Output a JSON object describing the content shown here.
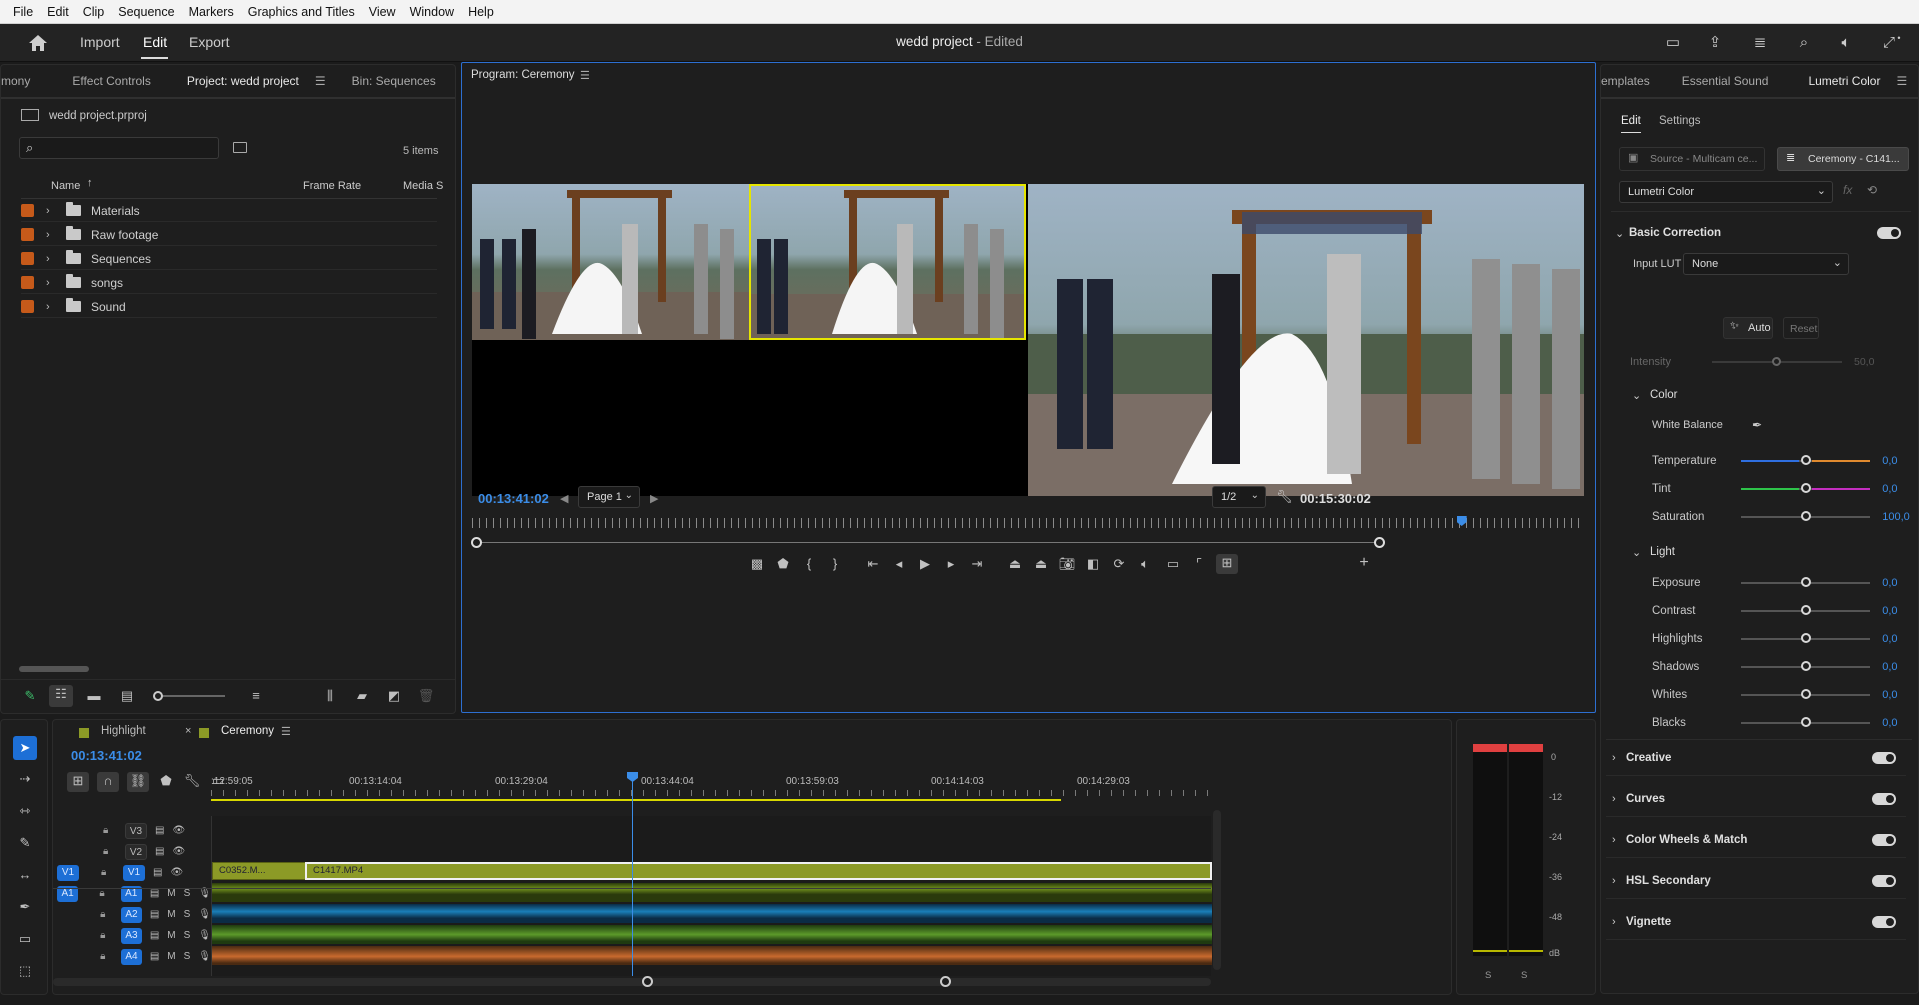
{
  "menu": [
    "File",
    "Edit",
    "Clip",
    "Sequence",
    "Markers",
    "Graphics and Titles",
    "View",
    "Window",
    "Help"
  ],
  "header": {
    "workspaces": [
      "Import",
      "Edit",
      "Export"
    ],
    "title": "wedd project",
    "title_suffix": " - Edited"
  },
  "project": {
    "tabs": [
      "mony",
      "Effect Controls",
      "Project: wedd project",
      "Bin: Sequences"
    ],
    "file": "wedd project.prproj",
    "item_count": "5 items",
    "columns": [
      "Name",
      "Frame Rate",
      "Media S"
    ],
    "items": [
      "Materials",
      "Raw footage",
      "Sequences",
      "songs",
      "Sound"
    ],
    "swatch_color": "#c65a1a"
  },
  "program": {
    "tab": "Program: Ceremony",
    "timecode_left": "00:13:41:02",
    "page": "Page 1",
    "resolution": "1/2",
    "timecode_right": "00:15:30:02",
    "playhead_fraction": 0.89
  },
  "timeline": {
    "tabs": [
      "Highlight",
      "Ceremony"
    ],
    "timecode": "00:13:41:02",
    "ruler": [
      ":12:59:05",
      "00:13:14:04",
      "00:13:29:04",
      "00:13:44:04",
      "00:13:59:03",
      "00:14:14:03",
      "00:14:29:03"
    ],
    "video_tracks": [
      "V3",
      "V2",
      "V1"
    ],
    "audio_tracks": [
      "A1",
      "A2",
      "A3",
      "A4"
    ],
    "clip_1": "C0352.M...",
    "clip_2": "C1417.MP4",
    "meter_scale": [
      "0",
      "-12",
      "-24",
      "-36",
      "-48",
      "dB"
    ],
    "meter_labels": [
      "S",
      "S"
    ],
    "colors": {
      "video_clip": "#8c9a26",
      "a1": "#6f8f1c",
      "a2": "#1a7fb8",
      "a3": "#5c9a2a",
      "a4": "#c86a2e",
      "playhead": "#3b8de8"
    }
  },
  "lumetri": {
    "tabs": [
      "emplates",
      "Essential Sound",
      "Lumetri Color"
    ],
    "subtabs": [
      "Edit",
      "Settings"
    ],
    "source": "Source - Multicam ce...",
    "target": "Ceremony - C141...",
    "effect": "Lumetri Color",
    "basic_correction": "Basic Correction",
    "input_lut_label": "Input LUT",
    "input_lut_value": "None",
    "auto": "Auto",
    "reset": "Reset",
    "intensity_label": "Intensity",
    "intensity_value": "50,0",
    "color_group": "Color",
    "white_balance": "White Balance",
    "color_controls": [
      {
        "label": "Temperature",
        "value": "0,0"
      },
      {
        "label": "Tint",
        "value": "0,0"
      },
      {
        "label": "Saturation",
        "value": "100,0"
      }
    ],
    "light_group": "Light",
    "light_controls": [
      {
        "label": "Exposure",
        "value": "0,0"
      },
      {
        "label": "Contrast",
        "value": "0,0"
      },
      {
        "label": "Highlights",
        "value": "0,0"
      },
      {
        "label": "Shadows",
        "value": "0,0"
      },
      {
        "label": "Whites",
        "value": "0,0"
      },
      {
        "label": "Blacks",
        "value": "0,0"
      }
    ],
    "sections": [
      "Creative",
      "Curves",
      "Color Wheels & Match",
      "HSL Secondary",
      "Vignette"
    ]
  }
}
